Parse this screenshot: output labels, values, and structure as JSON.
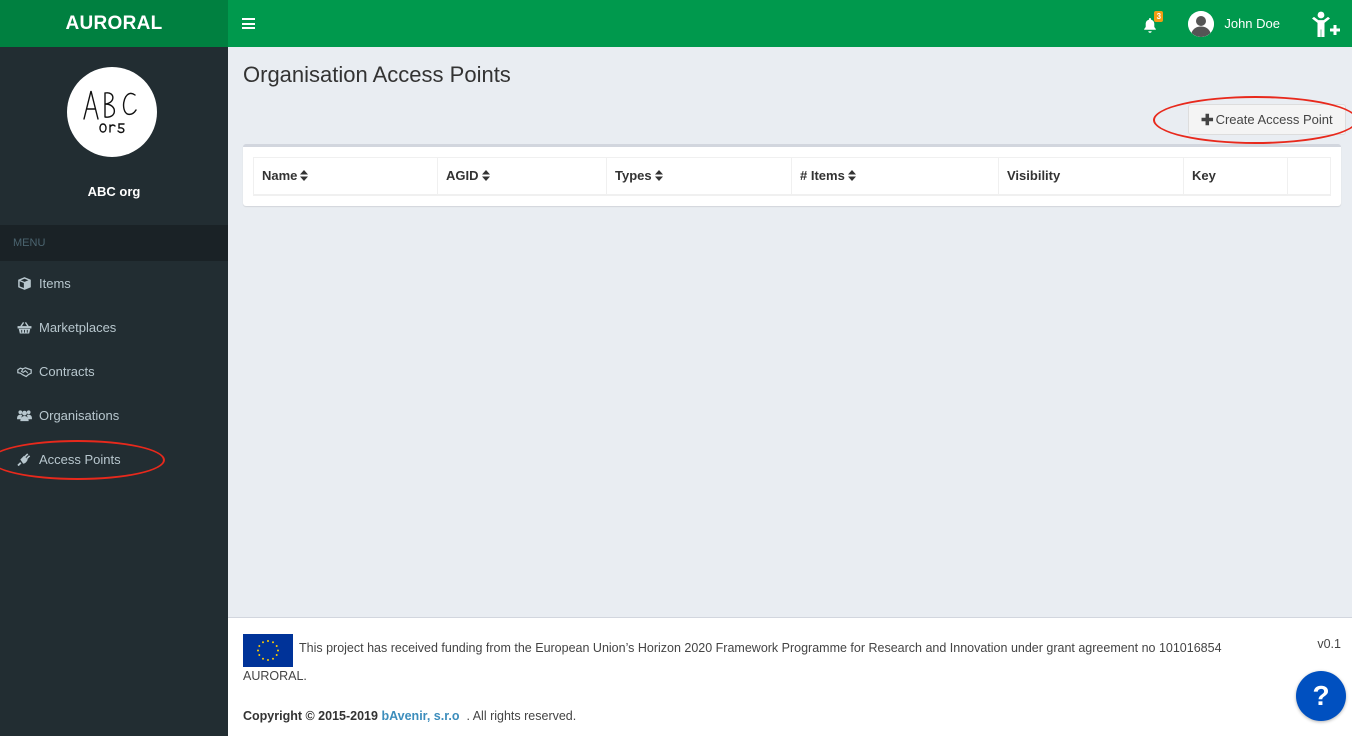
{
  "app": {
    "logo": "AURORAL"
  },
  "topbar": {
    "notifications_count": "3",
    "user_name": "John Doe"
  },
  "sidebar": {
    "org_logo_text": [
      "ABC",
      "org"
    ],
    "org_name": "ABC org",
    "menu_header": "MENU",
    "items": [
      {
        "label": "Items",
        "icon": "cube-icon"
      },
      {
        "label": "Marketplaces",
        "icon": "basket-icon"
      },
      {
        "label": "Contracts",
        "icon": "handshake-icon"
      },
      {
        "label": "Organisations",
        "icon": "users-icon"
      },
      {
        "label": "Access Points",
        "icon": "plug-icon"
      }
    ]
  },
  "main": {
    "title": "Organisation Access Points",
    "create_button": "Create Access Point",
    "table": {
      "columns": [
        {
          "label": "Name",
          "sortable": true
        },
        {
          "label": "AGID",
          "sortable": true
        },
        {
          "label": "Types",
          "sortable": true
        },
        {
          "label": "# Items",
          "sortable": true
        },
        {
          "label": "Visibility",
          "sortable": false
        },
        {
          "label": "Key",
          "sortable": false
        },
        {
          "label": "",
          "sortable": false
        }
      ],
      "rows": []
    }
  },
  "footer": {
    "funding_text": "This project has received funding from the European Union’s Horizon 2020 Framework Programme for Research and Innovation under grant agreement no 101016854",
    "funding_text_cont": "AURORAL.",
    "version": "v0.1",
    "copyright_prefix": "Copyright © 2015-2019",
    "company": "bAvenir, s.r.o",
    "copyright_suffix": ". All rights reserved."
  },
  "help_button": "?",
  "colors": {
    "brand_dark": "#008040",
    "brand": "#00994d",
    "sidebar_bg": "#222d32",
    "link": "#3c8dbc",
    "help": "#0050c0",
    "annotation": "#e8291c"
  }
}
